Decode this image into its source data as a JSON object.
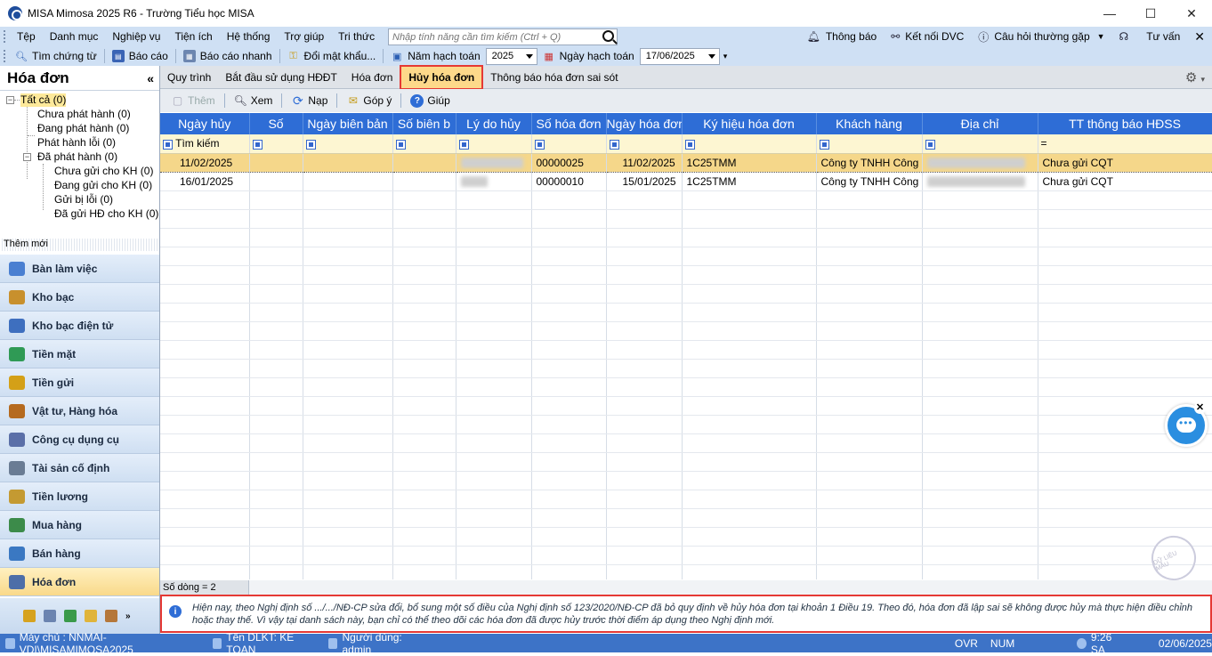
{
  "window": {
    "title": "MISA Mimosa 2025 R6 - Trường Tiểu học MISA",
    "minimize": "—",
    "maximize": "☐",
    "close": "✕"
  },
  "menu": {
    "items": [
      "Tệp",
      "Danh mục",
      "Nghiệp vụ",
      "Tiện ích",
      "Hệ thống",
      "Trợ giúp",
      "Tri thức"
    ],
    "search_placeholder": "Nhập tính năng cần tìm kiếm (Ctrl + Q)",
    "notification": "Thông báo",
    "connect": "Kết nối DVC",
    "faq": "Câu hỏi thường gặp",
    "consult": "Tư vấn"
  },
  "toolbar": {
    "find_voucher": "Tìm chứng từ",
    "report": "Báo cáo",
    "quick_report": "Báo cáo nhanh",
    "change_password": "Đổi mật khẩu...",
    "fiscal_year_label": "Năm hạch toán",
    "fiscal_year": "2025",
    "posting_date_label": "Ngày hạch toán",
    "posting_date": "17/06/2025"
  },
  "left": {
    "title": "Hóa đơn",
    "collapse": "«",
    "tree": [
      {
        "label": "Tất cả (0)"
      },
      {
        "label": "Chưa phát hành (0)"
      },
      {
        "label": "Đang phát hành (0)"
      },
      {
        "label": "Phát hành lỗi (0)"
      },
      {
        "label": "Đã phát hành (0)"
      },
      {
        "label": "Chưa gửi cho KH (0)"
      },
      {
        "label": "Đang gửi cho KH (0)"
      },
      {
        "label": "Gửi bị lỗi (0)"
      },
      {
        "label": "Đã gửi HĐ cho KH (0)"
      }
    ],
    "new_label": "Thêm mới",
    "nav": [
      {
        "label": "Bàn làm việc",
        "color": "#4a7fd1"
      },
      {
        "label": "Kho bạc",
        "color": "#c8902d"
      },
      {
        "label": "Kho bạc điện tử",
        "color": "#3e6fbf"
      },
      {
        "label": "Tiền mặt",
        "color": "#2f9a55"
      },
      {
        "label": "Tiền gửi",
        "color": "#d4a017"
      },
      {
        "label": "Vật tư, Hàng hóa",
        "color": "#b56a1f"
      },
      {
        "label": "Công cụ dụng cụ",
        "color": "#5b6fa8"
      },
      {
        "label": "Tài sản cố định",
        "color": "#6a7c94"
      },
      {
        "label": "Tiền lương",
        "color": "#c49a32"
      },
      {
        "label": "Mua hàng",
        "color": "#3c8b4a"
      },
      {
        "label": "Bán hàng",
        "color": "#3a78c2"
      },
      {
        "label": "Hóa đơn",
        "color": "#4d6ea8"
      }
    ]
  },
  "tabs": [
    "Quy trình",
    "Bắt đầu sử dụng HĐĐT",
    "Hóa đơn",
    "Hủy hóa đơn",
    "Thông báo hóa đơn sai sót"
  ],
  "actions": {
    "add": "Thêm",
    "view": "Xem",
    "reload": "Nạp",
    "feedback": "Góp ý",
    "help": "Giúp"
  },
  "grid": {
    "columns": [
      "Ngày hủy",
      "Số",
      "Ngày biên bản",
      "Số biên b",
      "Lý do hủy",
      "Số hóa đơn",
      "Ngày hóa đơn",
      "Ký hiệu hóa đơn",
      "Khách hàng",
      "Địa chỉ",
      "TT thông báo HĐSS"
    ],
    "filter_placeholder": "Tìm kiếm",
    "filter_eq": "=",
    "rows": [
      {
        "cancel_date": "11/02/2025",
        "no": "",
        "record_date": "",
        "record_no": "",
        "reason": "",
        "invoice_no": "00000025",
        "invoice_date": "11/02/2025",
        "symbol": "1C25TMM",
        "customer": "Công ty TNHH Công",
        "address": "",
        "status": "Chưa gửi CQT"
      },
      {
        "cancel_date": "16/01/2025",
        "no": "",
        "record_date": "",
        "record_no": "",
        "reason": "",
        "invoice_no": "00000010",
        "invoice_date": "15/01/2025",
        "symbol": "1C25TMM",
        "customer": "Công ty TNHH Công",
        "address": "",
        "status": "Chưa gửi CQT"
      }
    ],
    "row_count": "Số dòng = 2"
  },
  "note": "Hiện nay, theo Nghị định số .../.../NĐ-CP sửa đổi, bổ sung một số điều của Nghị định số 123/2020/NĐ-CP đã bỏ quy định về hủy hóa đơn tại khoản 1 Điều 19. Theo đó, hóa đơn đã lập sai sẽ không được hủy mà thực hiện điều chỉnh hoặc thay thế. Vì vậy tại danh sách này, bạn chỉ có thể theo dõi các hóa đơn đã được hủy trước thời điểm áp dụng theo Nghị định mới.",
  "status": {
    "server": "Máy chủ : NNMAI-VDI\\MISAMIMOSA2025",
    "db": "Tên DLKT: KE TOAN",
    "user": "Người dùng: admin",
    "ovr": "OVR",
    "num": "NUM",
    "time": "9:26 SA",
    "date": "02/06/2025"
  },
  "stamp": "DỮ LIỆU MẪU"
}
